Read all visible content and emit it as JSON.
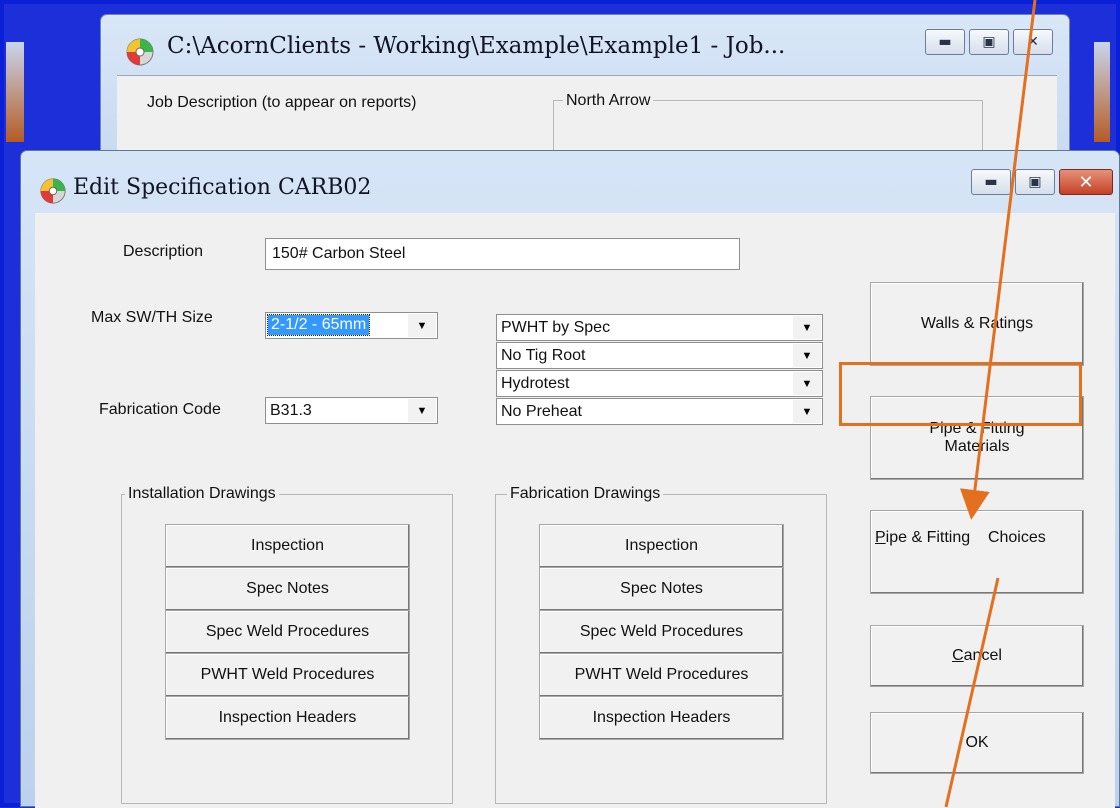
{
  "back_window": {
    "title": "C:\\AcornClients - Working\\Example\\Example1   -   Job...",
    "job_description_label": "Job Description (to appear on reports)",
    "north_arrow_label": "North Arrow"
  },
  "dialog": {
    "title": "Edit Specification  CARB02",
    "description_label": "Description",
    "description_value": "150# Carbon Steel",
    "max_size_label": "Max SW/TH Size",
    "max_size_value": "2-1/2 -  65mm",
    "fab_code_label": "Fabrication Code",
    "fab_code_value": "B31.3",
    "options": [
      "PWHT by Spec",
      "No Tig Root",
      "Hydrotest",
      "No Preheat"
    ],
    "installation_group_label": "Installation Drawings",
    "fabrication_group_label": "Fabrication Drawings",
    "drawing_buttons": [
      "Inspection",
      "Spec Notes",
      "Spec Weld Procedures",
      "PWHT Weld Procedures",
      "Inspection Headers"
    ],
    "walls_button": "Walls & Ratings",
    "materials_button_line1": "Pipe & Fitting",
    "materials_button_line2": "Materials",
    "choices_button_part1": "ipe & Fitting",
    "choices_button_accel": "P",
    "choices_button_part2": "Choices",
    "cancel_button_accel": "C",
    "cancel_button_rest": "ancel",
    "ok_button": "OK"
  },
  "annotation_color": "#e2701e"
}
